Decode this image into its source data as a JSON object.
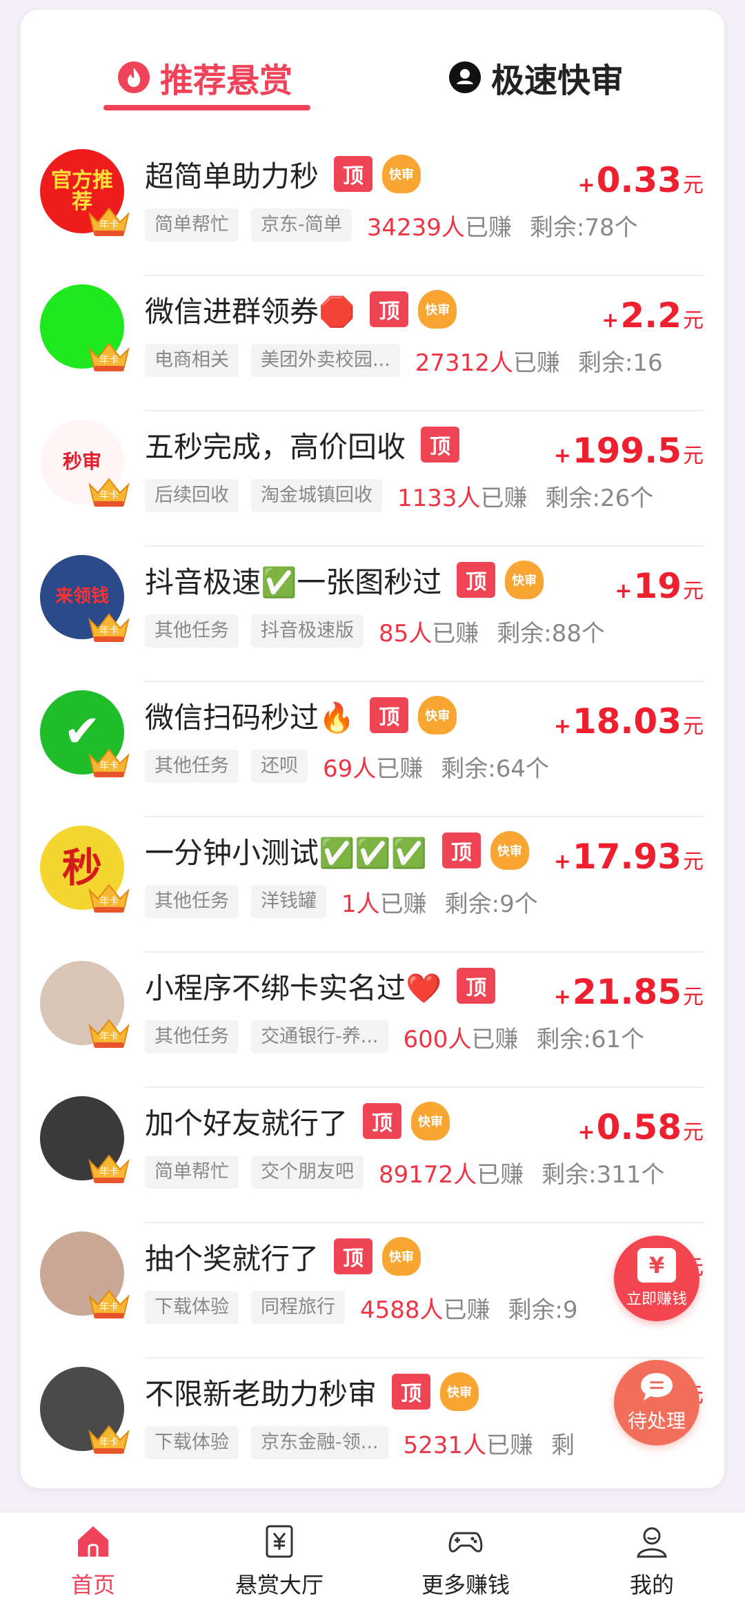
{
  "tabs": {
    "recommended": "推荐悬赏",
    "fast_review": "极速快审"
  },
  "badges": {
    "top": "顶",
    "fast": "快审",
    "year_card": "年卡"
  },
  "price_plus": "+",
  "price_unit": "元",
  "earned_suffix": "已赚",
  "tasks": [
    {
      "title": "超简单助力秒",
      "top": true,
      "fast": true,
      "price": "0.33",
      "tag1": "简单帮忙",
      "tag2": "京东-简单",
      "count": "34239人",
      "remain": "剩余:78个",
      "avatar_text": "官方推荐"
    },
    {
      "title": "微信进群领券🛑",
      "top": true,
      "fast": true,
      "price": "2.2",
      "tag1": "电商相关",
      "tag2": "美团外卖校园...",
      "count": "27312人",
      "remain": "剩余:16",
      "avatar_text": ""
    },
    {
      "title": "五秒完成，高价回收",
      "top": true,
      "fast": false,
      "price": "199.5",
      "tag1": "后续回收",
      "tag2": "淘金城镇回收",
      "count": "1133人",
      "remain": "剩余:26个",
      "avatar_text": "秒审"
    },
    {
      "title": "抖音极速✅一张图秒过",
      "top": true,
      "fast": true,
      "price": "19",
      "tag1": "其他任务",
      "tag2": "抖音极速版",
      "count": "85人",
      "remain": "剩余:88个",
      "avatar_text": "来领钱"
    },
    {
      "title": "微信扫码秒过🔥",
      "top": true,
      "fast": true,
      "price": "18.03",
      "tag1": "其他任务",
      "tag2": "还呗",
      "count": "69人",
      "remain": "剩余:64个",
      "avatar_text": "✔"
    },
    {
      "title": "一分钟小测试✅✅✅",
      "top": true,
      "fast": true,
      "price": "17.93",
      "tag1": "其他任务",
      "tag2": "洋钱罐",
      "count": "1人",
      "remain": "剩余:9个",
      "avatar_text": "秒"
    },
    {
      "title": "小程序不绑卡实名过❤️",
      "top": true,
      "fast": false,
      "price": "21.85",
      "tag1": "其他任务",
      "tag2": "交通银行-养...",
      "count": "600人",
      "remain": "剩余:61个",
      "avatar_text": ""
    },
    {
      "title": "加个好友就行了",
      "top": true,
      "fast": true,
      "price": "0.58",
      "tag1": "简单帮忙",
      "tag2": "交个朋友吧",
      "count": "89172人",
      "remain": "剩余:311个",
      "avatar_text": ""
    },
    {
      "title": "抽个奖就行了",
      "top": true,
      "fast": true,
      "price": "0.",
      "tag1": "下载体验",
      "tag2": "同程旅行",
      "count": "4588人",
      "remain": "剩余:9",
      "avatar_text": ""
    },
    {
      "title": "不限新老助力秒审",
      "top": true,
      "fast": true,
      "price": "",
      "tag1": "下载体验",
      "tag2": "京东金融-领...",
      "count": "5231人",
      "remain": "剩",
      "avatar_text": ""
    }
  ],
  "float_buttons": {
    "earn_now": "立即赚钱",
    "yen": "¥",
    "pending": "待处理"
  },
  "bottom_nav": [
    {
      "label": "首页",
      "icon": "home-icon",
      "active": true
    },
    {
      "label": "悬赏大厅",
      "icon": "reward-hall-icon",
      "active": false
    },
    {
      "label": "更多赚钱",
      "icon": "gamepad-icon",
      "active": false
    },
    {
      "label": "我的",
      "icon": "profile-icon",
      "active": false
    }
  ],
  "colors": {
    "accent": "#f0435a",
    "price": "#ee2030"
  }
}
